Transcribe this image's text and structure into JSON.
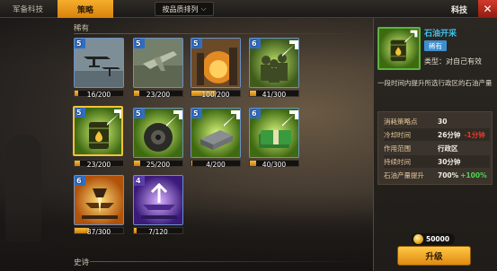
{
  "topbar": {
    "tab_military": "军备科技",
    "tab_strategy": "策略",
    "sort_label": "按品质排列",
    "title": "科技",
    "close": "✕"
  },
  "sections": {
    "rare": "稀有",
    "epic": "史诗"
  },
  "cards": [
    {
      "level": "5",
      "count": "16/200",
      "progress": 0.08
    },
    {
      "level": "5",
      "count": "23/200",
      "progress": 0.115
    },
    {
      "level": "5",
      "count": "100/200",
      "progress": 0.5
    },
    {
      "level": "6",
      "count": "41/300",
      "progress": 0.137
    },
    {
      "level": "5",
      "count": "23/200",
      "progress": 0.115
    },
    {
      "level": "5",
      "count": "25/200",
      "progress": 0.125
    },
    {
      "level": "5",
      "count": "4/200",
      "progress": 0.02
    },
    {
      "level": "6",
      "count": "40/300",
      "progress": 0.133
    },
    {
      "level": "6",
      "count": "87/300",
      "progress": 0.29
    },
    {
      "level": "4",
      "count": "7/120",
      "progress": 0.058
    }
  ],
  "detail": {
    "name": "石油开采",
    "rarity": "稀有",
    "type": "类型：对自己有效",
    "desc": "一段时间内提升所选行政区的石油产量",
    "stats": [
      {
        "k": "消耗策略点",
        "v": "30",
        "extra": "",
        "bonus": ""
      },
      {
        "k": "冷却时间",
        "v": "26分钟",
        "extra": "-1分钟",
        "bonus": ""
      },
      {
        "k": "作用范围",
        "v": "行政区",
        "extra": "",
        "bonus": ""
      },
      {
        "k": "持续时间",
        "v": "30分钟",
        "extra": "",
        "bonus": ""
      },
      {
        "k": "石油产量提升",
        "v": "700%",
        "extra": "",
        "bonus": "+100%"
      }
    ],
    "cost": "50000",
    "upgrade": "升级"
  },
  "colors": {
    "accent": "#f0a020",
    "rarity_blue": "#3e8fd0",
    "epic_purple": "#5b3db0",
    "name_cyan": "#3ec1ea",
    "cooldown_red": "#e53a2a",
    "bonus_green": "#4fd64b"
  }
}
